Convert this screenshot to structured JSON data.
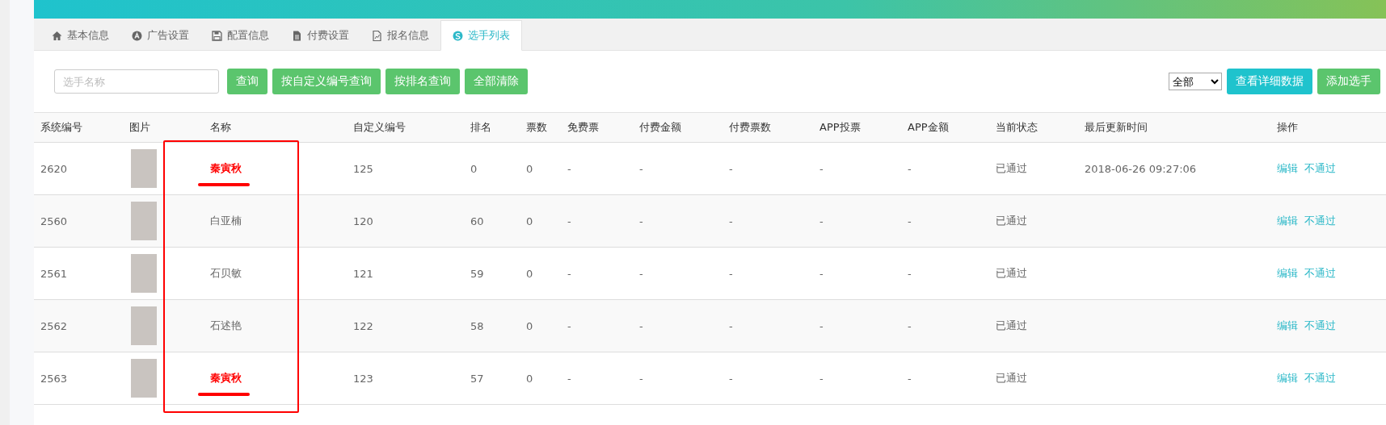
{
  "tabs": [
    {
      "label": "基本信息",
      "selected": false
    },
    {
      "label": "广告设置",
      "selected": false
    },
    {
      "label": "配置信息",
      "selected": false
    },
    {
      "label": "付费设置",
      "selected": false
    },
    {
      "label": "报名信息",
      "selected": false
    },
    {
      "label": "选手列表",
      "selected": true
    }
  ],
  "search": {
    "placeholder": "选手名称"
  },
  "query_buttons": [
    "查询",
    "按自定义编号查询",
    "按排名查询",
    "全部清除"
  ],
  "filter": {
    "value": "全部"
  },
  "right_buttons": [
    {
      "label": "查看详细数据",
      "kind": "info"
    },
    {
      "label": "添加选手",
      "kind": "success"
    }
  ],
  "table": {
    "columns": [
      "系统编号",
      "图片",
      "名称",
      "自定义编号",
      "排名",
      "票数",
      "免费票",
      "付费金额",
      "付费票数",
      "APP投票",
      "APP金额",
      "当前状态",
      "最后更新时间",
      "操作"
    ],
    "name_column_outlined": true,
    "rows": [
      {
        "id": "2620",
        "name": "秦寅秋",
        "highlighted": true,
        "custom_id": "125",
        "rank": "0",
        "votes": "0",
        "free_votes": "-",
        "paid_amount": "-",
        "paid_votes": "-",
        "app_votes": "-",
        "app_amount": "-",
        "status": "已通过",
        "updated": "2018-06-26 09:27:06",
        "actions": [
          "编辑",
          "不通过"
        ]
      },
      {
        "id": "2560",
        "name": "白亚楠",
        "highlighted": false,
        "custom_id": "120",
        "rank": "60",
        "votes": "0",
        "free_votes": "-",
        "paid_amount": "-",
        "paid_votes": "-",
        "app_votes": "-",
        "app_amount": "-",
        "status": "已通过",
        "actions": [
          "编辑",
          "不通过"
        ]
      },
      {
        "id": "2561",
        "name": "石贝敏",
        "highlighted": false,
        "custom_id": "121",
        "rank": "59",
        "votes": "0",
        "free_votes": "-",
        "paid_amount": "-",
        "paid_votes": "-",
        "app_votes": "-",
        "app_amount": "-",
        "status": "已通过",
        "actions": [
          "编辑",
          "不通过"
        ]
      },
      {
        "id": "2562",
        "name": "石述艳",
        "highlighted": false,
        "custom_id": "122",
        "rank": "58",
        "votes": "0",
        "free_votes": "-",
        "paid_amount": "-",
        "paid_votes": "-",
        "app_votes": "-",
        "app_amount": "-",
        "status": "已通过",
        "actions": [
          "编辑",
          "不通过"
        ]
      },
      {
        "id": "2563",
        "name": "秦寅秋",
        "highlighted": true,
        "custom_id": "123",
        "rank": "57",
        "votes": "0",
        "free_votes": "-",
        "paid_amount": "-",
        "paid_votes": "-",
        "app_votes": "-",
        "app_amount": "-",
        "status": "已通过",
        "actions": [
          "编辑",
          "不通过"
        ]
      }
    ]
  }
}
